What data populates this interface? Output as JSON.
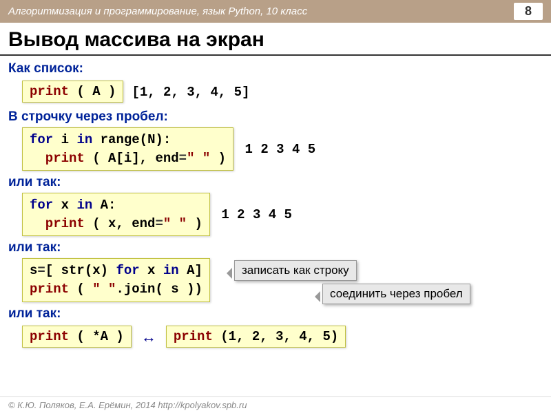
{
  "header": {
    "breadcrumb": "Алгоритмизация и программирование, язык Python, 10 класс",
    "page": "8"
  },
  "title": "Вывод массива на экран",
  "sections": {
    "s1": "Как список:",
    "s2": "В строчку через пробел:",
    "s3": "или так:",
    "s4": "или так:",
    "s5": "или так:"
  },
  "code": {
    "c1a": "print",
    "c1b": " ( A )",
    "c2a": "for",
    "c2b": " i ",
    "c2c": "in",
    "c2d": " range(N):",
    "c2e": "  print",
    "c2f": " ( A[i], end",
    "c2g": "=",
    "c2h": "\" \"",
    "c2i": " )",
    "c3a": "for",
    "c3b": " x ",
    "c3c": "in",
    "c3d": " A:",
    "c3e": "  print",
    "c3f": " ( x, end",
    "c3g": "=",
    "c3h": "\" \"",
    "c3i": " )",
    "c4a": "s",
    "c4b": "=",
    "c4c": "[",
    "c4d": " str(x) ",
    "c4e": "for",
    "c4f": " x ",
    "c4g": "in",
    "c4h": " A]",
    "c4i": "print",
    "c4j": " ( ",
    "c4k": "\" \"",
    "c4l": ".join( s ))",
    "c5a": "print",
    "c5b": " ( *A )",
    "c6a": "print",
    "c6b": " (1, 2, 3, 4, 5)"
  },
  "output": {
    "o1": "[1, 2, 3, 4, 5]",
    "o2": "1 2 3 4 5",
    "o3": "1 2 3 4 5"
  },
  "callouts": {
    "c1": "записать как строку",
    "c2": "соединить через пробел"
  },
  "arrow": "↔",
  "footer": "© К.Ю. Поляков, Е.А. Ерёмин, 2014   http://kpolyakov.spb.ru"
}
